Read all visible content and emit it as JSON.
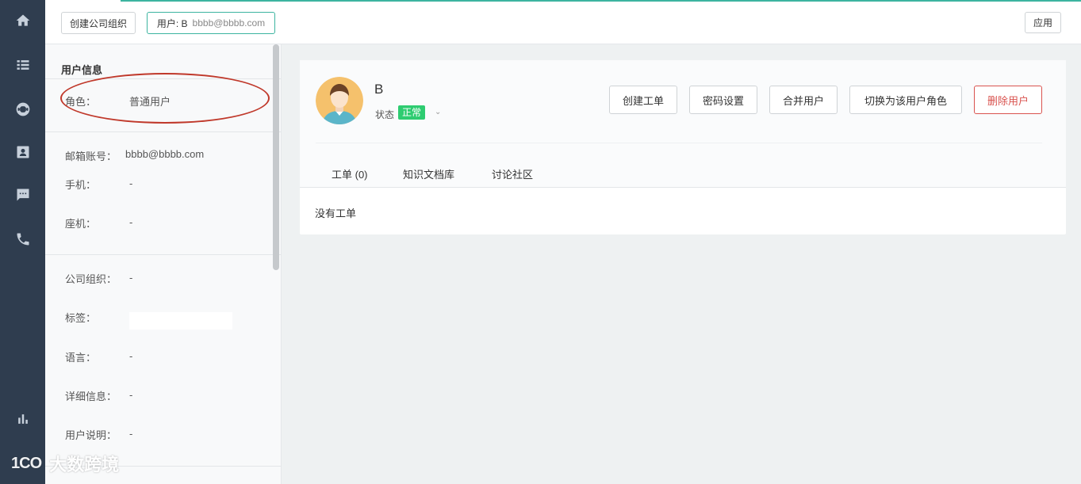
{
  "nav": {
    "items": [
      {
        "icon": "home-icon"
      },
      {
        "icon": "list-icon"
      },
      {
        "icon": "lifebuoy-icon"
      },
      {
        "icon": "contact-card-icon"
      },
      {
        "icon": "chat-icon"
      },
      {
        "icon": "phone-icon"
      },
      {
        "icon": "bar-chart-icon"
      }
    ]
  },
  "topbar": {
    "create_org_label": "创建公司组织",
    "user_tab_prefix": "用户: B",
    "user_tab_email": "bbbb@bbbb.com",
    "apply_label": "应用"
  },
  "user_info": {
    "title": "用户信息",
    "role_label": "角色：",
    "role_value": "普通用户",
    "email_label": "邮箱账号：",
    "email_value": "bbbb@bbbb.com",
    "mobile_label": "手机：",
    "mobile_value": "-",
    "landline_label": "座机：",
    "landline_value": "-",
    "org_label": "公司组织：",
    "org_value": "-",
    "tags_label": "标签：",
    "language_label": "语言：",
    "language_value": "-",
    "details_label": "详细信息：",
    "details_value": "-",
    "note_label": "用户说明：",
    "note_value": "-"
  },
  "profile": {
    "name": "B",
    "status_label": "状态",
    "status_value": "正常",
    "actions": {
      "create_ticket": "创建工单",
      "password": "密码设置",
      "merge": "合并用户",
      "switch_role": "切换为该用户角色",
      "delete": "删除用户"
    },
    "tabs": [
      "工单 (0)",
      "知识文档库",
      "讨论社区"
    ],
    "empty_text": "没有工单"
  },
  "watermark": {
    "logo": "1CO",
    "text": "大数跨境"
  },
  "colors": {
    "nav_bg": "#2f3d4f",
    "accent": "#3cb4a0",
    "status_green": "#2ecc71",
    "danger": "#d9534f"
  }
}
